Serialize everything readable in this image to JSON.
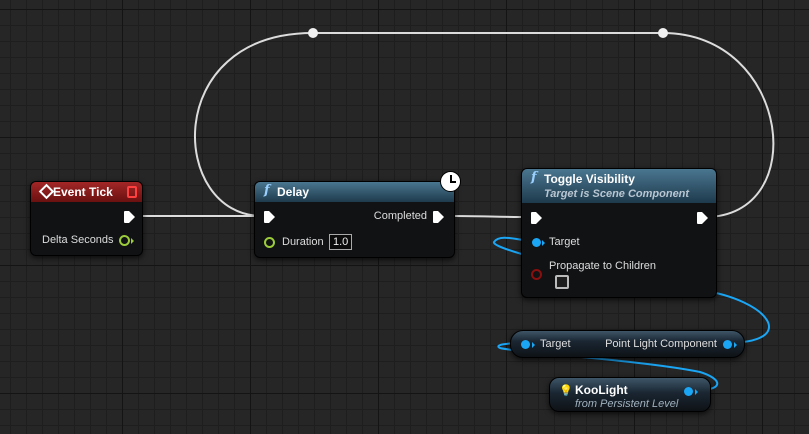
{
  "nodes": {
    "event_tick": {
      "title": "Event Tick",
      "pins": {
        "delta_seconds": "Delta Seconds"
      }
    },
    "delay": {
      "title": "Delay",
      "pins": {
        "completed": "Completed",
        "duration": "Duration"
      },
      "duration_value": "1.0"
    },
    "toggle_visibility": {
      "title": "Toggle Visibility",
      "subtitle": "Target is Scene Component",
      "pins": {
        "target": "Target",
        "propagate": "Propagate to Children"
      }
    },
    "get_component": {
      "pins": {
        "target": "Target",
        "output": "Point Light Component"
      }
    },
    "koolight": {
      "title": "KooLight",
      "subtitle": "from Persistent Level"
    }
  },
  "colors": {
    "event_header": "#8c1e1e",
    "function_header": "#24465c",
    "object_pin": "#1ba6f5",
    "float_pin": "#9ccc3a",
    "bool_pin": "#8a0f0f",
    "exec_wire": "#e0e0e0"
  },
  "icons": [
    "event-diamond-icon",
    "function-icon",
    "clock-icon",
    "light-bulb-icon"
  ]
}
